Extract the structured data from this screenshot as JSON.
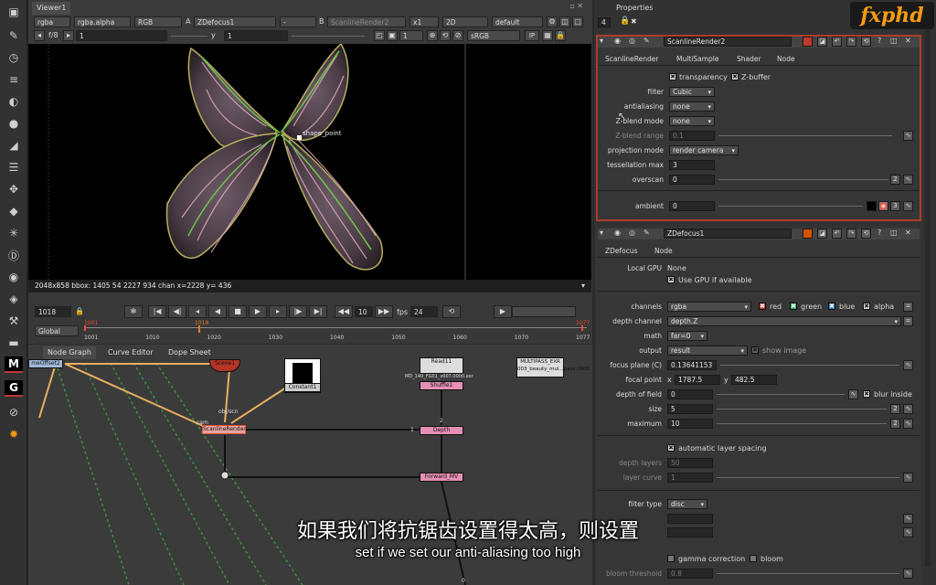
{
  "toolbar": {
    "icons": [
      "node-graph-icon",
      "brush-icon",
      "clock-icon",
      "channel-icon",
      "color-icon",
      "sphere-icon",
      "filter-icon",
      "layers-icon",
      "transform-icon",
      "3d-cube-icon",
      "particles-icon",
      "deep-icon",
      "views-icon",
      "metadata-icon",
      "toolsets-icon",
      "other-icon",
      "merge-icon",
      "gizmo-icon",
      "gizmo2-icon",
      "fire-icon"
    ]
  },
  "viewer": {
    "tab": "Viewer1",
    "layer": "rgba",
    "channel": "rgba.alpha",
    "display": "RGB",
    "a_label": "A",
    "a_input": "ZDefocus1",
    "mid_op": "-",
    "b_label": "B",
    "b_input": "ScanlineRender2",
    "zoom": "x1",
    "mode": "2D",
    "lut": "default",
    "fstop": "f/8",
    "gain": "1",
    "gamma_label": "y",
    "gamma": "1",
    "proxy": "1",
    "colorspace": "sRGB",
    "ip": "IP",
    "info": "2048x858 bbox: 1405 54 2227 934 chan  x=2228 y= 436",
    "pivot_label": "shape_point",
    "frame": "1018",
    "scope": "Global",
    "increment": "10",
    "fps_label": "fps",
    "fps": "24",
    "ruler_labels": [
      "1001",
      "1010",
      "1020",
      "1030",
      "1040",
      "1050",
      "1060",
      "1070",
      "1077"
    ],
    "in_point": "1001",
    "cur_marker": "1018",
    "out_point": "1077"
  },
  "nodegraph": {
    "tabs": [
      "Node Graph",
      "Curve Editor",
      "Dope Sheet"
    ],
    "nodes": {
      "timeoffset": "meOffset2",
      "scene": "Scene1",
      "constant": "Constant1",
      "scanline": "ScanlineRender",
      "cam": "cam",
      "obj": "obj/scn",
      "read": "Read11",
      "read_path": "MD_140_FG01_v007.0000.exr",
      "multipass": "MULTIPASS_EXR",
      "multipass_sub": "003_beauty_mul...pass.0000",
      "shuffle": "Shuffle1",
      "depth": "Depth",
      "forward": "Forward_MV",
      "pipe1": "1",
      "pipe2": "2",
      "pipe3": "0"
    }
  },
  "properties": {
    "title": "Properties",
    "max_panels": "4",
    "lock_icon": "lock-icon",
    "clear": "✖",
    "scanline_node": {
      "name": "ScanlineRender2",
      "tabs": [
        "ScanlineRender",
        "MultiSample",
        "Shader",
        "Node"
      ],
      "transparency": "transparency",
      "zbuffer": "Z-buffer",
      "filter_label": "filter",
      "filter": "Cubic",
      "antialiasing_label": "antialiasing",
      "antialiasing": "none",
      "zblend_mode_label": "Z-blend mode",
      "zblend_mode": "none",
      "zblend_range_label": "Z-blend range",
      "zblend_range": "0.1",
      "projection_label": "projection mode",
      "projection": "render camera",
      "tess_label": "tessellation max",
      "tess": "3",
      "overscan_label": "overscan",
      "overscan": "0",
      "overscan_n": "2",
      "ambient_label": "ambient",
      "ambient": "0",
      "ambient_n": "3"
    },
    "zdefocus_node": {
      "name": "ZDefocus1",
      "tabs": [
        "ZDefocus",
        "Node"
      ],
      "local_gpu_label": "Local GPU",
      "local_gpu": "None",
      "use_gpu": "Use GPU if available",
      "channels_label": "channels",
      "channels": "rgba",
      "red": "red",
      "green": "green",
      "blue": "blue",
      "alpha": "alpha",
      "depth_label": "depth channel",
      "depth": "depth.Z",
      "math_label": "math",
      "math": "far=0",
      "output_label": "output",
      "output": "result",
      "show_image": "show image",
      "focus_label": "focus plane (C)",
      "focus": "0.13641153",
      "fpoint_label": "focal point",
      "fpoint_x_label": "x",
      "fpoint_x": "1787.5",
      "fpoint_y_label": "y",
      "fpoint_y": "482.5",
      "dof_label": "depth of field",
      "dof": "0",
      "blur_inside": "blur inside",
      "size_label": "size",
      "size": "5",
      "size_n": "2",
      "max_label": "maximum",
      "max": "10",
      "max_n": "2",
      "auto_layer": "automatic layer spacing",
      "depth_layers_label": "depth layers",
      "depth_layers": "50",
      "layer_curve_label": "layer curve",
      "layer_curve": "1",
      "filter_type_label": "filter type",
      "filter_type": "disc",
      "gamma_corr": "gamma correction",
      "bloom": "bloom",
      "bloom_thresh_label": "bloom threshold",
      "bloom_thresh": "0.8"
    }
  },
  "logo": {
    "text": "fxphd"
  },
  "subtitle": {
    "zh": "如果我们将抗锯齿设置得太高，则设置",
    "en": "set if we set our anti-aliasing too high"
  },
  "colors": {
    "accent_red": "#b03a2e",
    "shuffle_pink": "#e58fb4",
    "scanline_node": "#e8a6a0",
    "logo_orange": "#f39c12"
  }
}
